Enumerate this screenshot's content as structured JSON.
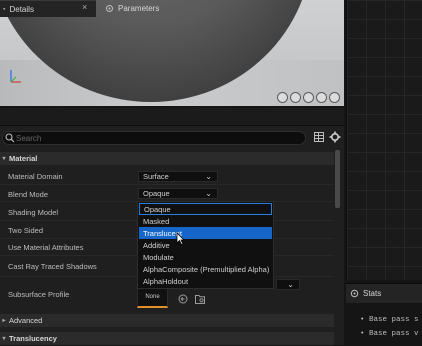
{
  "tabs": {
    "details": "Details",
    "parameters": "Parameters"
  },
  "search": {
    "placeholder": "Search"
  },
  "sections": {
    "material": "Material",
    "advanced": "Advanced",
    "translucency": "Translucency"
  },
  "properties": [
    {
      "label": "Material Domain",
      "value": "Surface"
    },
    {
      "label": "Blend Mode",
      "value": "Opaque"
    },
    {
      "label": "Shading Model"
    },
    {
      "label": "Two Sided"
    },
    {
      "label": "Use Material Attributes"
    },
    {
      "label": "Cast Ray Traced Shadows"
    },
    {
      "label": "Subsurface Profile",
      "thumb": "None"
    }
  ],
  "blend_mode_options": [
    "Opaque",
    "Masked",
    "Translucent",
    "Additive",
    "Modulate",
    "AlphaComposite (Premultiplied Alpha)",
    "AlphaHoldout"
  ],
  "blend_mode_highlighted": "Translucent",
  "stats": {
    "title": "Stats",
    "lines": [
      "• Base pass s",
      "• Base pass v"
    ]
  },
  "colors": {
    "accent": "#1665c9",
    "selection_outline": "#2a7de1",
    "thumb_underline": "#e0902a",
    "panel_bg": "#1f1f1f"
  },
  "icons": [
    "axis-gizmo-icon",
    "close-icon",
    "parameters-icon",
    "search-icon",
    "table-view-icon",
    "settings-icon",
    "chevron-down-icon",
    "arrow-left-icon",
    "browse-icon",
    "stats-icon"
  ]
}
